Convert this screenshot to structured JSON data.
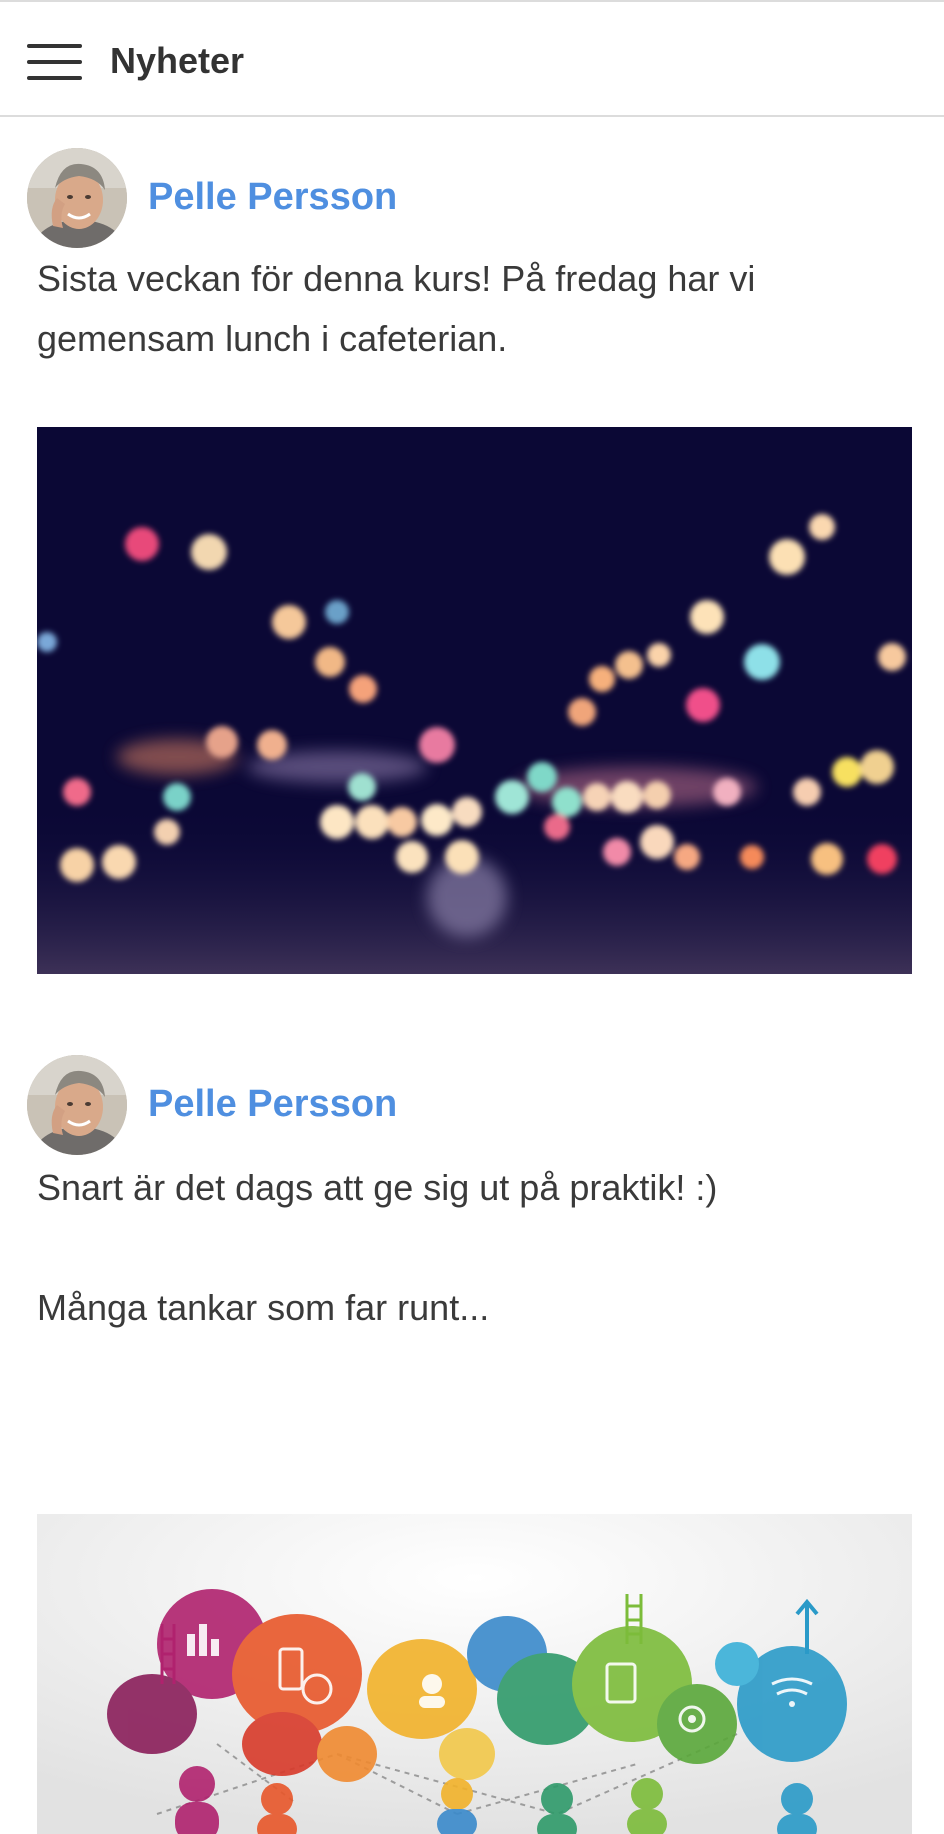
{
  "header": {
    "title": "Nyheter",
    "menu_icon": "hamburger-menu-icon"
  },
  "posts": [
    {
      "author": "Pelle Persson",
      "text_lines": [
        "Sista veckan för denna kurs! På fredag har vi",
        "gemensam lunch i cafeterian."
      ],
      "image": "blurred-city-lights-photo"
    },
    {
      "author": "Pelle Persson",
      "text_lines": [
        "Snart är det dags att ge sig ut på praktik! :)",
        "",
        "Många tankar som far runt..."
      ],
      "image": "colorful-speech-bubbles-illustration"
    }
  ],
  "colors": {
    "author_link": "#4f8fe0",
    "text": "#3a3a3a",
    "header_border": "#dcdcdc"
  }
}
